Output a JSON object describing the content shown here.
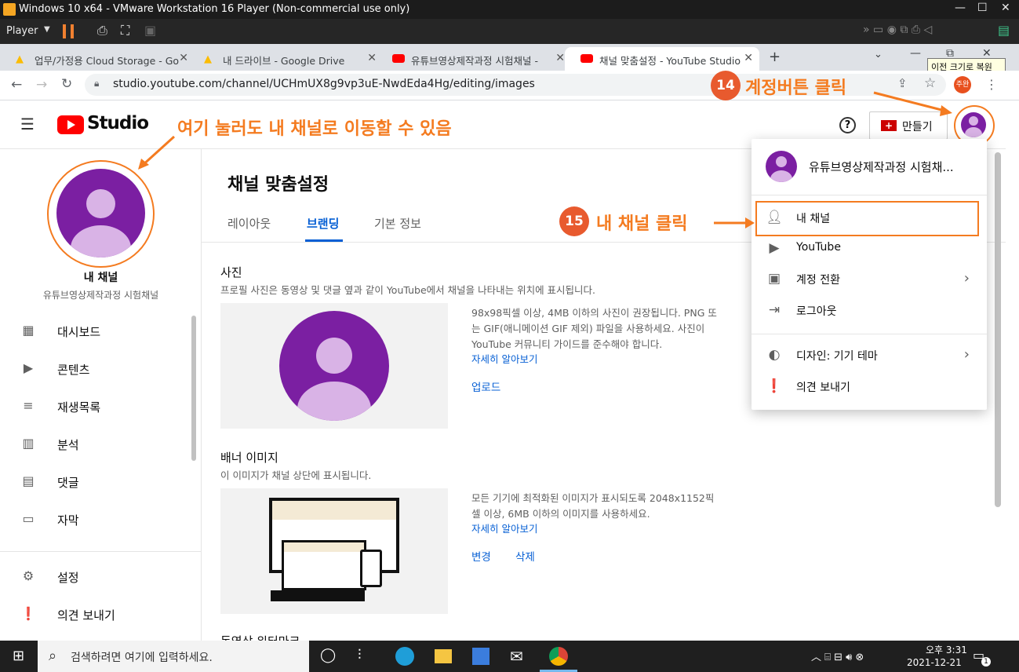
{
  "vmware": {
    "title": "Windows 10 x64 - VMware Workstation 16 Player (Non-commercial use only)",
    "player_menu": "Player",
    "restore_tooltip": "이전 크기로 복원"
  },
  "browser": {
    "tabs": [
      {
        "label": "업무/가정용 Cloud Storage - Go"
      },
      {
        "label": "내 드라이브 - Google Drive"
      },
      {
        "label": "유튜브영상제작과정 시험채널 -"
      },
      {
        "label": "채널 맞춤설정 - YouTube Studio"
      }
    ],
    "url": "studio.youtube.com/channel/UCHmUX8g9vp3uE-NwdEda4Hg/editing/images",
    "profile_badge": "주완"
  },
  "studio": {
    "logo_text": "Studio",
    "create_label": "만들기"
  },
  "sidebar": {
    "channel_title": "내 채널",
    "channel_name": "유튜브영상제작과정 시험채널",
    "items": [
      {
        "label": "대시보드",
        "icon": "dashboard-icon"
      },
      {
        "label": "콘텐츠",
        "icon": "content-icon"
      },
      {
        "label": "재생목록",
        "icon": "playlist-icon"
      },
      {
        "label": "분석",
        "icon": "analytics-icon"
      },
      {
        "label": "댓글",
        "icon": "comments-icon"
      },
      {
        "label": "자막",
        "icon": "subtitles-icon"
      }
    ],
    "bottom": [
      {
        "label": "설정",
        "icon": "gear-icon"
      },
      {
        "label": "의견 보내기",
        "icon": "feedback-icon"
      }
    ]
  },
  "main": {
    "title": "채널 맞춤설정",
    "tabs": [
      "레이아웃",
      "브랜딩",
      "기본 정보"
    ],
    "active_tab": "브랜딩",
    "photo": {
      "heading": "사진",
      "desc": "프로필 사진은 동영상 및 댓글 옆과 같이 YouTube에서 채널을 나타내는 위치에 표시됩니다.",
      "info1": "98x98픽셀 이상, 4MB 이하의 사진이 권장됩니다. PNG 또",
      "info2": "는 GIF(애니메이션 GIF 제외) 파일을 사용하세요. 사진이",
      "info3": "YouTube 커뮤니티 가이드를 준수해야 합니다.",
      "learn_more": "자세히 알아보기",
      "upload": "업로드"
    },
    "banner": {
      "heading": "배너 이미지",
      "desc": "이 이미지가 채널 상단에 표시됩니다.",
      "info1": "모든 기기에 최적화된 이미지가 표시되도록 2048x1152픽",
      "info2": "셀 이상, 6MB 이하의 이미지를 사용하세요.",
      "learn_more": "자세히 알아보기",
      "change": "변경",
      "delete": "삭제"
    },
    "next_heading": "동영상 워터마크"
  },
  "account_menu": {
    "channel_name": "유튜브영상제작과정 시험채...",
    "items": [
      {
        "label": "내 채널",
        "icon": "person-icon"
      },
      {
        "label": "YouTube",
        "icon": "youtube-icon"
      },
      {
        "label": "계정 전환",
        "icon": "switch-account-icon",
        "chevron": true
      },
      {
        "label": "로그아웃",
        "icon": "sign-out-icon"
      }
    ],
    "items2": [
      {
        "label": "디자인: 기기 테마",
        "icon": "theme-icon",
        "chevron": true
      },
      {
        "label": "의견 보내기",
        "icon": "feedback-icon"
      }
    ]
  },
  "annotations": {
    "sidebar_note": "여기 눌러도 내 채널로 이동할 수 있음",
    "step14_num": "14",
    "step14_text": "계정버튼 클릭",
    "step15_num": "15",
    "step15_text": "내 채널 클릭"
  },
  "taskbar": {
    "search_placeholder": "검색하려면 여기에 입력하세요.",
    "time": "오후 3:31",
    "date": "2021-12-21",
    "notification_count": "1"
  },
  "colors": {
    "accent_orange": "#f47b20",
    "badge_orange": "#e85a2e",
    "avatar_purple": "#7b1fa2",
    "link_blue": "#065fd4",
    "youtube_red": "#ff0000"
  }
}
